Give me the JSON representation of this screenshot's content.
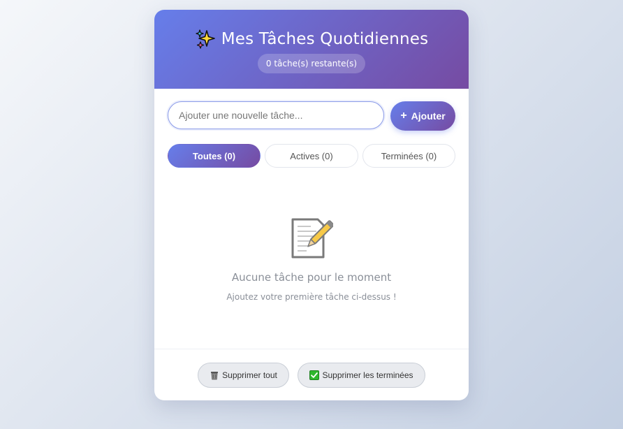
{
  "header": {
    "title": "Mes Tâches Quotidiennes",
    "title_icon": "sparkles-icon",
    "counter": "0 tâche(s) restante(s)"
  },
  "input": {
    "placeholder": "Ajouter une nouvelle tâche...",
    "value": ""
  },
  "add_button": {
    "label": "Ajouter",
    "icon": "plus-icon"
  },
  "filters": [
    {
      "label": "Toutes (0)",
      "active": true
    },
    {
      "label": "Actives (0)",
      "active": false
    },
    {
      "label": "Terminées (0)",
      "active": false
    }
  ],
  "empty_state": {
    "icon": "memo-icon",
    "title": "Aucune tâche pour le moment",
    "subtitle": "Ajoutez votre première tâche ci-dessus !"
  },
  "footer": {
    "delete_all_label": "Supprimer tout",
    "delete_all_icon": "trash-icon",
    "delete_done_label": "Supprimer les terminées",
    "delete_done_icon": "check-box-icon"
  },
  "colors": {
    "gradient_start": "#667eea",
    "gradient_end": "#764ba2",
    "check_green": "#2eb82e"
  }
}
